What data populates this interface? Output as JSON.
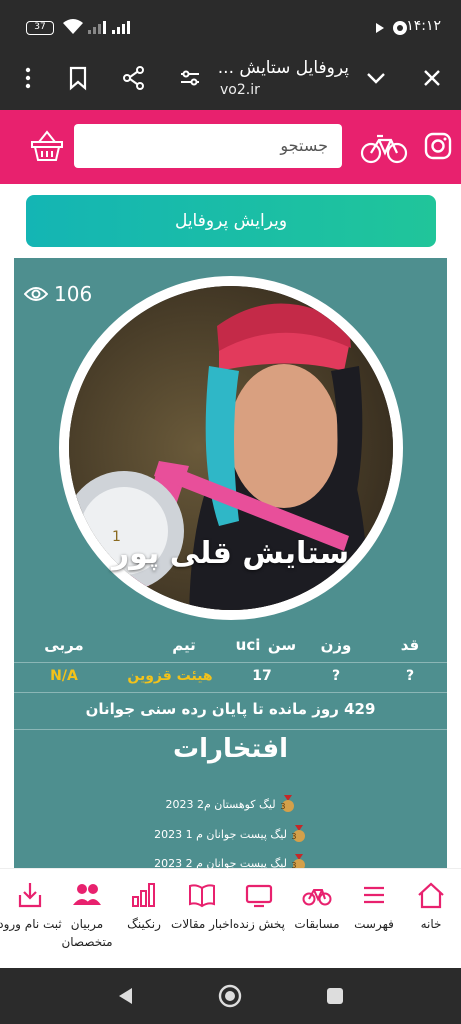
{
  "status_bar": {
    "time": "۱۴:۱۲",
    "battery": "37"
  },
  "browser": {
    "title": "پروفایل ستایش ...",
    "url": "vo2.ir"
  },
  "search": {
    "placeholder": "جستجو"
  },
  "profile": {
    "edit_button": "ویرایش پروفایل",
    "views": "106",
    "name": "ستایش قلی پور",
    "stats_headers": {
      "height": "قد",
      "weight": "وزن",
      "age": "سن",
      "uci": "uci",
      "team": "تیم",
      "coach": "مربی"
    },
    "stats_values": {
      "height": "?",
      "weight": "?",
      "age": "17",
      "team": "هیئت قزوین",
      "coach": "N/A"
    },
    "days_remaining": "429 روز مانده تا پایان رده سنی جوانان",
    "achievements_title": "افتخارات",
    "achievements": [
      {
        "label": "لیگ کوهستان م2 2023",
        "medal": "3"
      },
      {
        "label": "لیگ پیست جوانان م 1 2023",
        "medal": "3"
      },
      {
        "label": "لیگ پیست جوانان م 2 2023",
        "medal": "3"
      }
    ]
  },
  "bottom_nav": [
    {
      "id": "home",
      "label": "خانه",
      "icon": "home-icon"
    },
    {
      "id": "list",
      "label": "فهرست",
      "icon": "menu-icon"
    },
    {
      "id": "races",
      "label": "مسابقات",
      "icon": "bicycle-icon"
    },
    {
      "id": "live",
      "label": "پخش زنده",
      "icon": "tv-icon"
    },
    {
      "id": "news",
      "label": "اخبار مقالات",
      "icon": "book-icon"
    },
    {
      "id": "ranking",
      "label": "رنکینگ",
      "icon": "bar-chart-icon"
    },
    {
      "id": "coaches",
      "label": "مربیان متخصصان",
      "icon": "users-icon"
    },
    {
      "id": "login",
      "label": "ثبت نام ورود",
      "icon": "login-icon"
    }
  ],
  "colors": {
    "brand_pink": "#e8216e",
    "card_teal": "#4e8f8f",
    "gold": "#f2c21b",
    "button_teal": "#14b5b4"
  }
}
